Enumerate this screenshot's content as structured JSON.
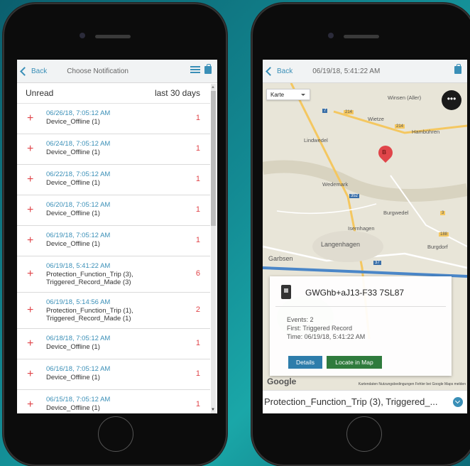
{
  "left": {
    "nav": {
      "back": "Back",
      "title": "Choose Notification"
    },
    "subheader": {
      "left": "Unread",
      "right": "last 30 days"
    },
    "rows": [
      {
        "date": "06/26/18, 7:05:12 AM",
        "desc": "Device_Offline (1)",
        "count": "1"
      },
      {
        "date": "06/24/18, 7:05:12 AM",
        "desc": "Device_Offline (1)",
        "count": "1"
      },
      {
        "date": "06/22/18, 7:05:12 AM",
        "desc": "Device_Offline (1)",
        "count": "1"
      },
      {
        "date": "06/20/18, 7:05:12 AM",
        "desc": "Device_Offline (1)",
        "count": "1"
      },
      {
        "date": "06/19/18, 7:05:12 AM",
        "desc": "Device_Offline (1)",
        "count": "1"
      },
      {
        "date": "06/19/18, 5:41:22 AM",
        "desc": "Protection_Function_Trip (3),\nTriggered_Record_Made (3)",
        "count": "6"
      },
      {
        "date": "06/19/18, 5:14:56 AM",
        "desc": "Protection_Function_Trip (1),\nTriggered_Record_Made (1)",
        "count": "2"
      },
      {
        "date": "06/18/18, 7:05:12 AM",
        "desc": "Device_Offline (1)",
        "count": "1"
      },
      {
        "date": "06/16/18, 7:05:12 AM",
        "desc": "Device_Offline (1)",
        "count": "1"
      },
      {
        "date": "06/15/18, 7:05:12 AM",
        "desc": "Device_Offline (1)",
        "count": "1"
      }
    ]
  },
  "right": {
    "nav": {
      "back": "Back",
      "title": "06/19/18, 5:41:22 AM"
    },
    "map_type": "Karte",
    "more": "•••",
    "pin_label": "B",
    "places": {
      "winsen": "Winsen (Aller)",
      "wietze": "Wietze",
      "hambuhren": "Hambühren",
      "lindwedel": "Lindwedel",
      "wedemark": "Wedemark",
      "burgwedel": "Burgwedel",
      "isernhagen": "Isernhagen",
      "langenhagen": "Langenhagen",
      "garbsen": "Garbsen",
      "burgdorf": "Burgdorf",
      "r214a": "214",
      "r214b": "214",
      "r352": "352",
      "r188": "188",
      "r7": "7",
      "r3": "3",
      "r37": "37"
    },
    "card": {
      "device": "GWGhb+aJ13-F33 7SL87",
      "events": "Events: 2",
      "first": "First: Triggered Record",
      "time": "Time: 06/19/18, 5:41:22 AM",
      "details": "Details",
      "locate": "Locate in Map"
    },
    "google": "Google",
    "attribution": "Kartendaten   Nutzungsbedingungen   Fehler bei Google Maps melden",
    "bottom": "Protection_Function_Trip (3), Triggered_..."
  }
}
